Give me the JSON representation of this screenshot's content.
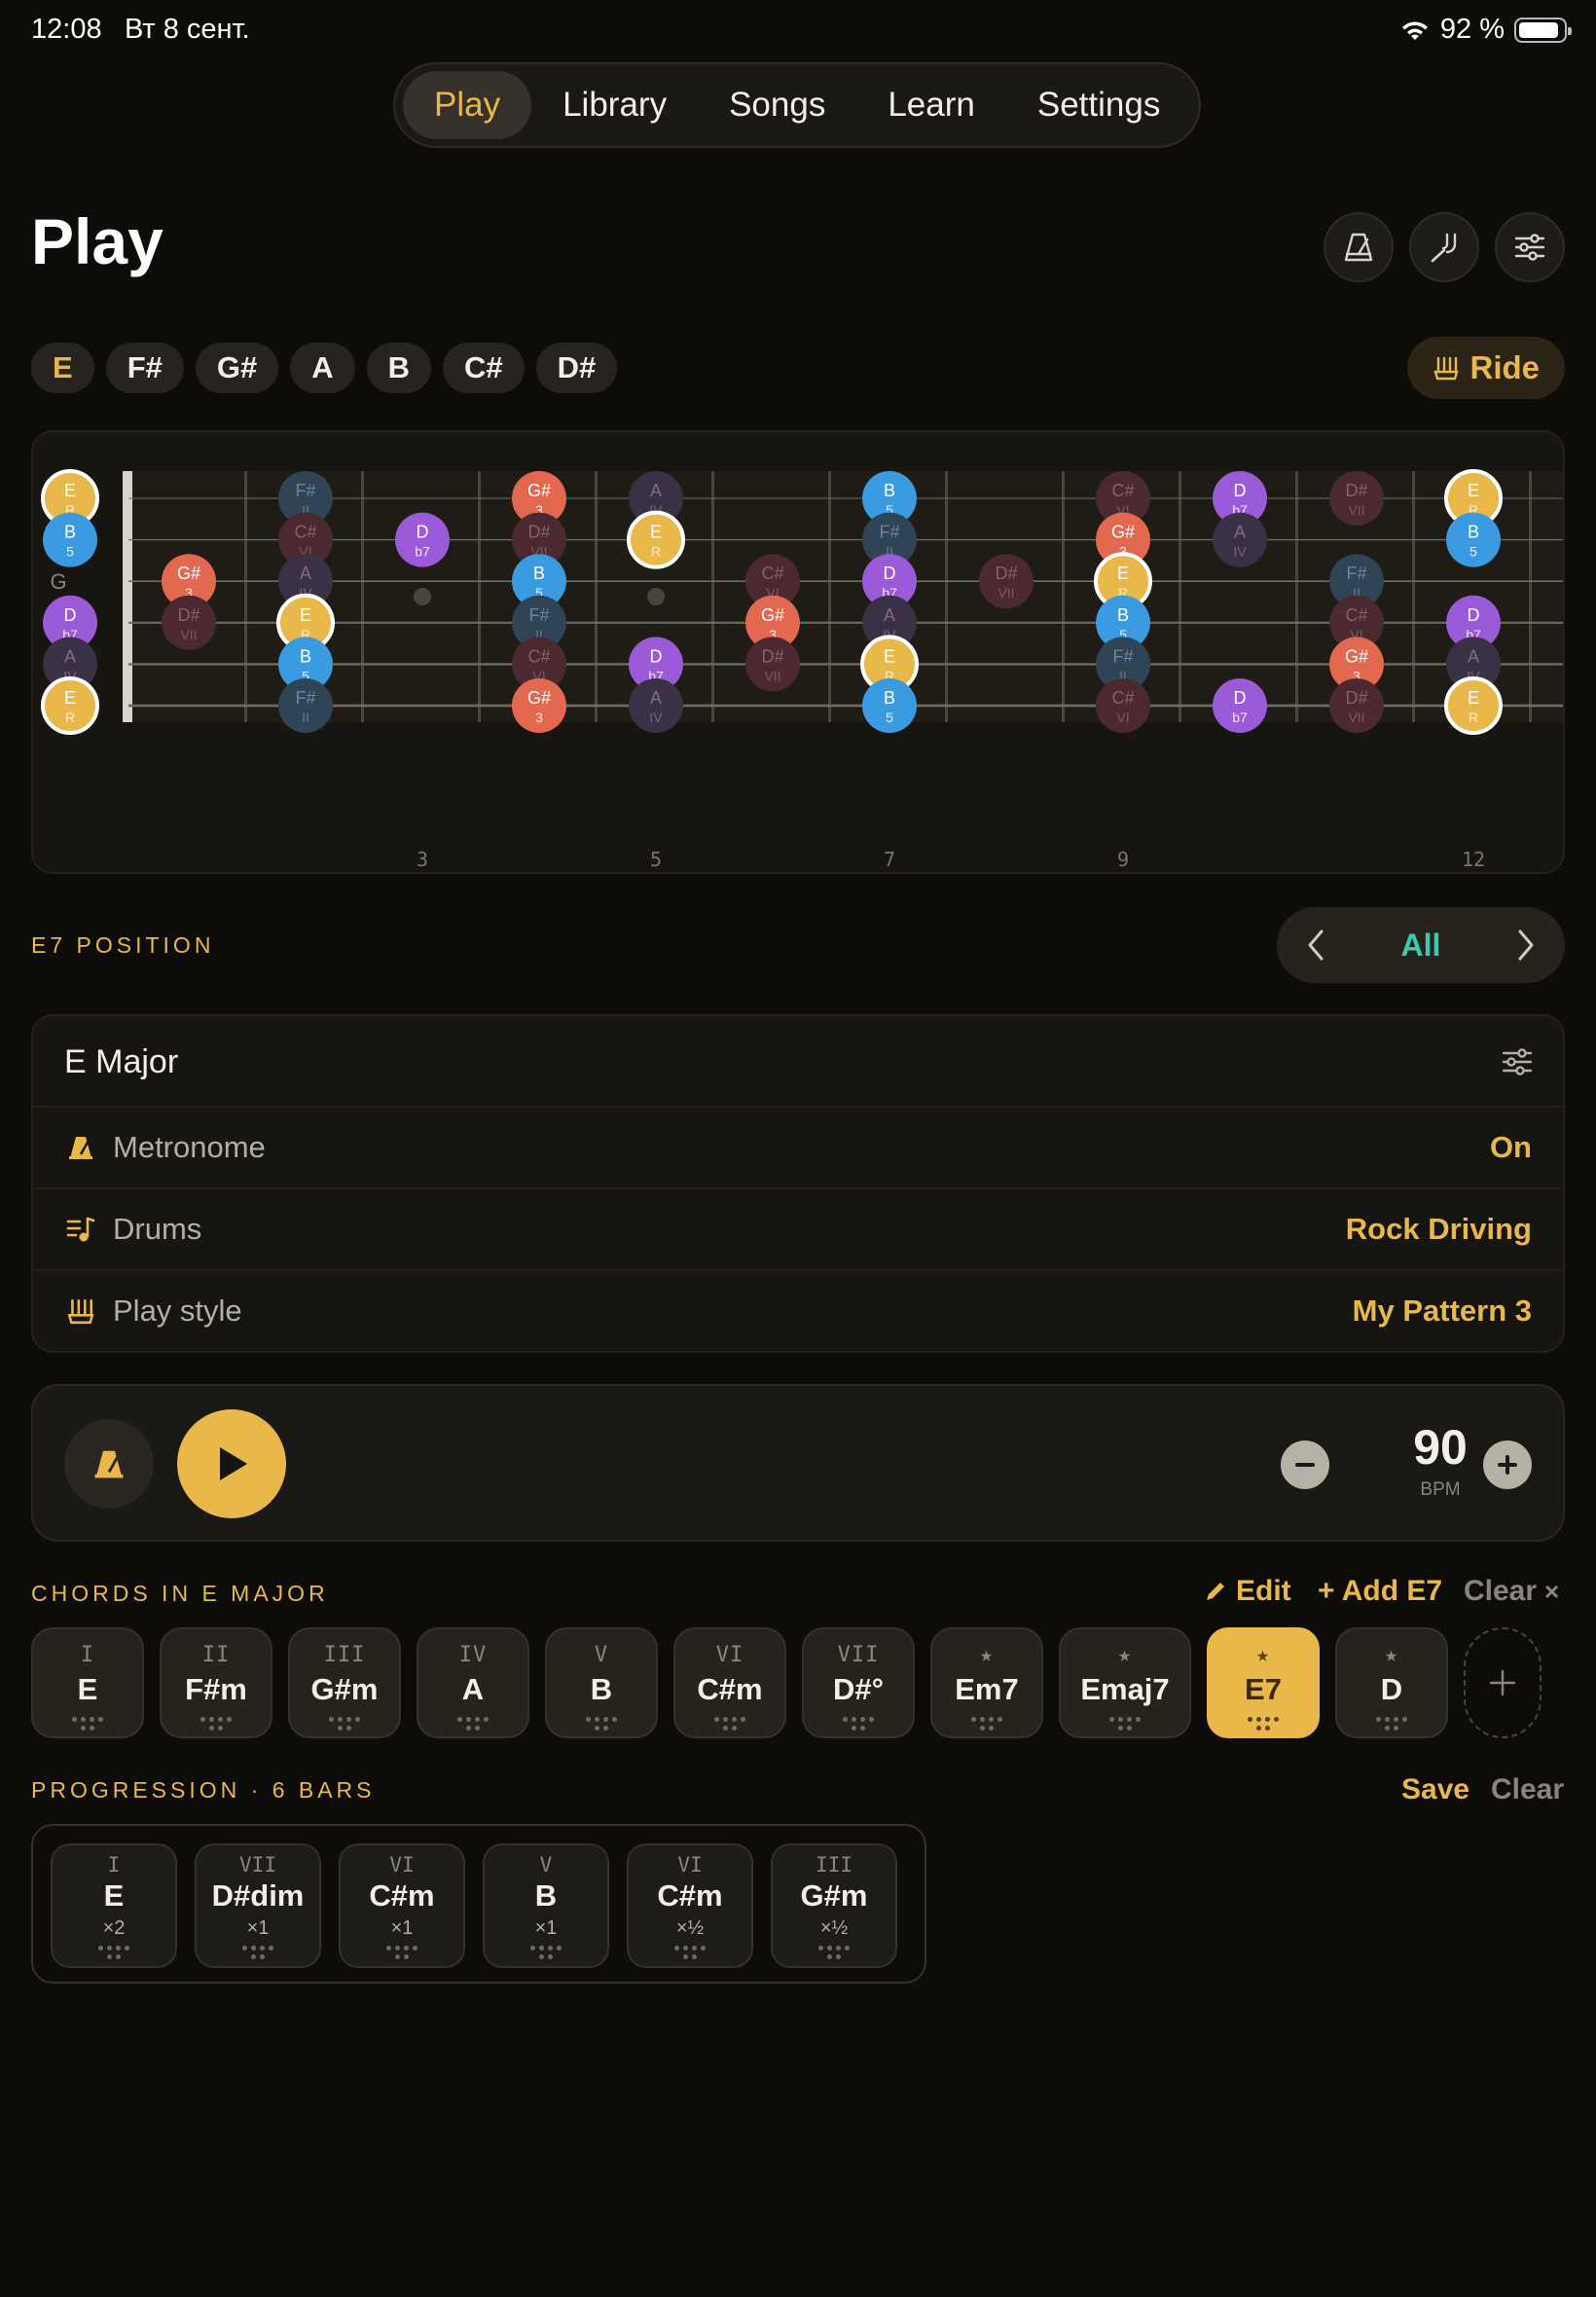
{
  "status": {
    "time": "12:08",
    "date": "Вт 8 сент.",
    "battery": "92 %"
  },
  "nav": {
    "tabs": [
      {
        "label": "Play",
        "active": true
      },
      {
        "label": "Library"
      },
      {
        "label": "Songs"
      },
      {
        "label": "Learn"
      },
      {
        "label": "Settings"
      }
    ]
  },
  "page": {
    "title": "Play"
  },
  "scale_notes": [
    "E",
    "F#",
    "G#",
    "A",
    "B",
    "C#",
    "D#"
  ],
  "ride": {
    "label": "Ride"
  },
  "fretboard": {
    "strings": [
      "e",
      "B",
      "G",
      "D",
      "A",
      "E"
    ],
    "fret_numbers": [
      "3",
      "5",
      "7",
      "9",
      "12"
    ],
    "notes": [
      {
        "s": 0,
        "f": 0,
        "n": "E",
        "d": "R",
        "t": "R"
      },
      {
        "s": 0,
        "f": 2,
        "n": "F#",
        "d": "II",
        "t": "dim"
      },
      {
        "s": 0,
        "f": 4,
        "n": "G#",
        "d": "3",
        "t": "3"
      },
      {
        "s": 0,
        "f": 5,
        "n": "A",
        "d": "IV",
        "t": "dim4"
      },
      {
        "s": 0,
        "f": 7,
        "n": "B",
        "d": "5",
        "t": "5"
      },
      {
        "s": 0,
        "f": 9,
        "n": "C#",
        "d": "VI",
        "t": "dim6"
      },
      {
        "s": 0,
        "f": 10,
        "n": "D",
        "d": "b7",
        "t": "b7"
      },
      {
        "s": 0,
        "f": 11,
        "n": "D#",
        "d": "VII",
        "t": "dim6"
      },
      {
        "s": 0,
        "f": 12,
        "n": "E",
        "d": "R",
        "t": "R"
      },
      {
        "s": 1,
        "f": 0,
        "n": "B",
        "d": "5",
        "t": "5"
      },
      {
        "s": 1,
        "f": 2,
        "n": "C#",
        "d": "VI",
        "t": "dim6"
      },
      {
        "s": 1,
        "f": 3,
        "n": "D",
        "d": "b7",
        "t": "b7"
      },
      {
        "s": 1,
        "f": 4,
        "n": "D#",
        "d": "VII",
        "t": "dim6"
      },
      {
        "s": 1,
        "f": 5,
        "n": "E",
        "d": "R",
        "t": "R"
      },
      {
        "s": 1,
        "f": 7,
        "n": "F#",
        "d": "II",
        "t": "dim"
      },
      {
        "s": 1,
        "f": 9,
        "n": "G#",
        "d": "3",
        "t": "3"
      },
      {
        "s": 1,
        "f": 10,
        "n": "A",
        "d": "IV",
        "t": "dim4"
      },
      {
        "s": 1,
        "f": 12,
        "n": "B",
        "d": "5",
        "t": "5"
      },
      {
        "s": 2,
        "f": 1,
        "n": "G#",
        "d": "3",
        "t": "3"
      },
      {
        "s": 2,
        "f": 2,
        "n": "A",
        "d": "IV",
        "t": "dim4"
      },
      {
        "s": 2,
        "f": 4,
        "n": "B",
        "d": "5",
        "t": "5"
      },
      {
        "s": 2,
        "f": 6,
        "n": "C#",
        "d": "VI",
        "t": "dim6"
      },
      {
        "s": 2,
        "f": 7,
        "n": "D",
        "d": "b7",
        "t": "b7"
      },
      {
        "s": 2,
        "f": 8,
        "n": "D#",
        "d": "VII",
        "t": "dim6"
      },
      {
        "s": 2,
        "f": 9,
        "n": "E",
        "d": "R",
        "t": "R"
      },
      {
        "s": 2,
        "f": 11,
        "n": "F#",
        "d": "II",
        "t": "dim"
      },
      {
        "s": 3,
        "f": 0,
        "n": "D",
        "d": "b7",
        "t": "b7"
      },
      {
        "s": 3,
        "f": 1,
        "n": "D#",
        "d": "VII",
        "t": "dim6"
      },
      {
        "s": 3,
        "f": 2,
        "n": "E",
        "d": "R",
        "t": "R"
      },
      {
        "s": 3,
        "f": 4,
        "n": "F#",
        "d": "II",
        "t": "dim"
      },
      {
        "s": 3,
        "f": 6,
        "n": "G#",
        "d": "3",
        "t": "3"
      },
      {
        "s": 3,
        "f": 7,
        "n": "A",
        "d": "IV",
        "t": "dim4"
      },
      {
        "s": 3,
        "f": 9,
        "n": "B",
        "d": "5",
        "t": "5"
      },
      {
        "s": 3,
        "f": 11,
        "n": "C#",
        "d": "VI",
        "t": "dim6"
      },
      {
        "s": 3,
        "f": 12,
        "n": "D",
        "d": "b7",
        "t": "b7"
      },
      {
        "s": 4,
        "f": 0,
        "n": "A",
        "d": "IV",
        "t": "dim4"
      },
      {
        "s": 4,
        "f": 2,
        "n": "B",
        "d": "5",
        "t": "5"
      },
      {
        "s": 4,
        "f": 4,
        "n": "C#",
        "d": "VI",
        "t": "dim6"
      },
      {
        "s": 4,
        "f": 5,
        "n": "D",
        "d": "b7",
        "t": "b7"
      },
      {
        "s": 4,
        "f": 6,
        "n": "D#",
        "d": "VII",
        "t": "dim6"
      },
      {
        "s": 4,
        "f": 7,
        "n": "E",
        "d": "R",
        "t": "R"
      },
      {
        "s": 4,
        "f": 9,
        "n": "F#",
        "d": "II",
        "t": "dim"
      },
      {
        "s": 4,
        "f": 11,
        "n": "G#",
        "d": "3",
        "t": "3"
      },
      {
        "s": 4,
        "f": 12,
        "n": "A",
        "d": "IV",
        "t": "dim4"
      },
      {
        "s": 5,
        "f": 0,
        "n": "E",
        "d": "R",
        "t": "R"
      },
      {
        "s": 5,
        "f": 2,
        "n": "F#",
        "d": "II",
        "t": "dim"
      },
      {
        "s": 5,
        "f": 4,
        "n": "G#",
        "d": "3",
        "t": "3"
      },
      {
        "s": 5,
        "f": 5,
        "n": "A",
        "d": "IV",
        "t": "dim4"
      },
      {
        "s": 5,
        "f": 7,
        "n": "B",
        "d": "5",
        "t": "5"
      },
      {
        "s": 5,
        "f": 9,
        "n": "C#",
        "d": "VI",
        "t": "dim6"
      },
      {
        "s": 5,
        "f": 10,
        "n": "D",
        "d": "b7",
        "t": "b7"
      },
      {
        "s": 5,
        "f": 11,
        "n": "D#",
        "d": "VII",
        "t": "dim6"
      },
      {
        "s": 5,
        "f": 12,
        "n": "E",
        "d": "R",
        "t": "R"
      }
    ]
  },
  "position": {
    "label": "E7 POSITION",
    "value": "All"
  },
  "settings_card": {
    "title": "E Major",
    "rows": [
      {
        "icon": "metronome-icon",
        "name": "Metronome",
        "value": "On"
      },
      {
        "icon": "drums-icon",
        "name": "Drums",
        "value": "Rock Driving"
      },
      {
        "icon": "strum-icon",
        "name": "Play style",
        "value": "My Pattern 3"
      }
    ]
  },
  "player": {
    "bpm": "90",
    "bpm_unit": "BPM"
  },
  "chords_section": {
    "label": "CHORDS IN E MAJOR",
    "edit": "Edit",
    "add": "+ Add E7",
    "clear": "Clear",
    "clear_x": "×"
  },
  "chords": [
    {
      "num": "I",
      "name": "E"
    },
    {
      "num": "II",
      "name": "F#m"
    },
    {
      "num": "III",
      "name": "G#m"
    },
    {
      "num": "IV",
      "name": "A"
    },
    {
      "num": "V",
      "name": "B"
    },
    {
      "num": "VI",
      "name": "C#m"
    },
    {
      "num": "VII",
      "name": "D#°"
    },
    {
      "num": "★",
      "name": "Em7"
    },
    {
      "num": "★",
      "name": "Emaj7"
    },
    {
      "num": "★",
      "name": "E7",
      "selected": true
    },
    {
      "num": "★",
      "name": "D"
    }
  ],
  "progression_section": {
    "label": "PROGRESSION · 6 BARS",
    "save": "Save",
    "clear": "Clear"
  },
  "progression": [
    {
      "num": "I",
      "name": "E",
      "rep": "×2"
    },
    {
      "num": "VII",
      "name": "D#dim",
      "rep": "×1"
    },
    {
      "num": "VI",
      "name": "C#m",
      "rep": "×1"
    },
    {
      "num": "V",
      "name": "B",
      "rep": "×1"
    },
    {
      "num": "VI",
      "name": "C#m",
      "rep": "×½"
    },
    {
      "num": "III",
      "name": "G#m",
      "rep": "×½"
    }
  ],
  "colors": {
    "accent": "#e9b84a",
    "teal": "#3ec8b0",
    "root": "#e9b84a",
    "third": "#e2694f",
    "fifth": "#3b9be0",
    "b7": "#9b5ad8"
  }
}
